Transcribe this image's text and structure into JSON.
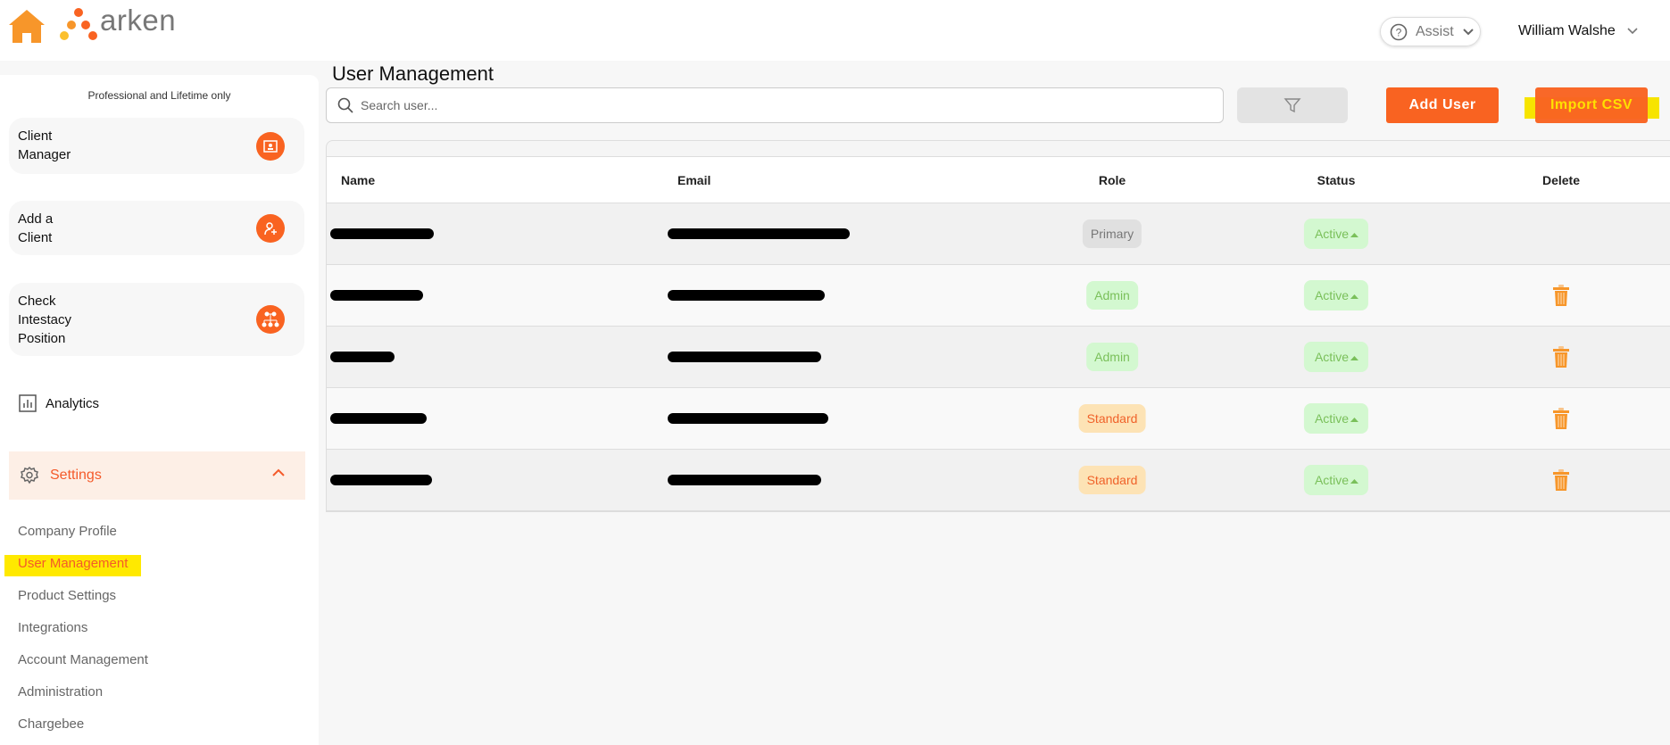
{
  "header": {
    "logo_text": "arken",
    "assist_label": "Assist",
    "user_name": "William Walshe"
  },
  "sidebar": {
    "plan_note": "Professional and Lifetime only",
    "cards": [
      {
        "label_lines": [
          "Client",
          "Manager"
        ]
      },
      {
        "label_lines": [
          "Add a",
          "Client"
        ]
      },
      {
        "label_lines": [
          "Check",
          "Intestacy",
          "Position"
        ]
      }
    ],
    "analytics": "Analytics",
    "settings": "Settings",
    "submenu": [
      "Company Profile",
      "User Management",
      "Product Settings",
      "Integrations",
      "Account Management",
      "Administration",
      "Chargebee"
    ],
    "active_submenu": "User Management"
  },
  "main": {
    "title": "User Management",
    "search_placeholder": "Search user...",
    "add_user": "Add User",
    "import_csv": "Import CSV",
    "columns": [
      "Name",
      "Email",
      "Role",
      "Status",
      "Delete"
    ],
    "rows": [
      {
        "role": "Primary",
        "status": "Active"
      },
      {
        "role": "Admin",
        "status": "Active"
      },
      {
        "role": "Admin",
        "status": "Active"
      },
      {
        "role": "Standard",
        "status": "Active"
      },
      {
        "role": "Standard",
        "status": "Active"
      }
    ]
  },
  "colors": {
    "accent": "#f96321",
    "highlight": "#ffe900",
    "active_green": "#7ac05a"
  }
}
